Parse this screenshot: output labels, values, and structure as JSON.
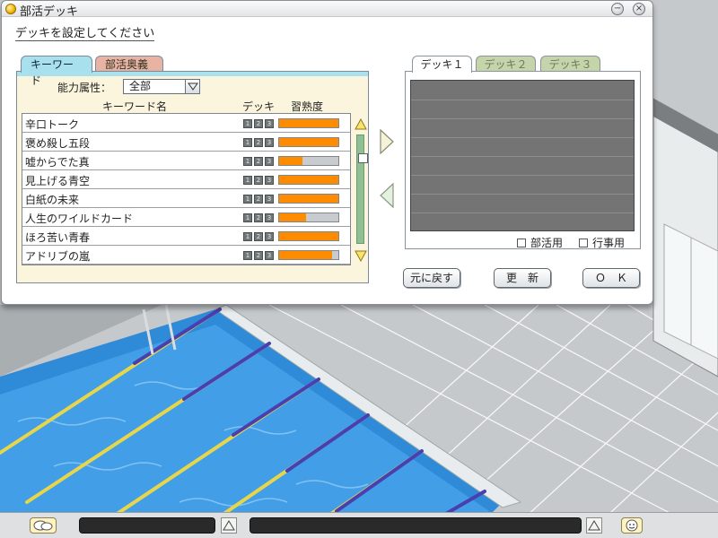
{
  "window": {
    "title": "部活デッキ",
    "prompt": "デッキを設定してください"
  },
  "left_tabs": [
    {
      "label": "キーワード",
      "active": true
    },
    {
      "label": "部活奥義",
      "active": false
    }
  ],
  "filter": {
    "label": "能力属性：",
    "value": "全部"
  },
  "columns": {
    "name": "キーワード名",
    "deck": "デッキ",
    "skill": "習熟度"
  },
  "keywords": [
    {
      "name": "辛口トーク",
      "proficiency": 1.0
    },
    {
      "name": "褒め殺し五段",
      "proficiency": 1.0
    },
    {
      "name": "嘘からでた真",
      "proficiency": 0.4
    },
    {
      "name": "見上げる青空",
      "proficiency": 1.0
    },
    {
      "name": "白紙の未来",
      "proficiency": 1.0
    },
    {
      "name": "人生のワイルドカード",
      "proficiency": 0.45
    },
    {
      "name": "ほろ苦い青春",
      "proficiency": 1.0
    },
    {
      "name": "アドリブの嵐",
      "proficiency": 0.9
    }
  ],
  "deck_slot_labels": [
    "1",
    "2",
    "3"
  ],
  "deck_tabs": [
    {
      "label": "デッキ１",
      "active": true
    },
    {
      "label": "デッキ２",
      "active": false
    },
    {
      "label": "デッキ３",
      "active": false
    }
  ],
  "deck_checks": {
    "club": "部活用",
    "event": "行事用"
  },
  "buttons": {
    "reset": "元に戻す",
    "update": "更　新",
    "ok": "Ｏ　Ｋ"
  },
  "colors": {
    "proficiency": "#ff8c00",
    "active_tab": "#a8e0ee",
    "inactive_tab": "#e8b3a2",
    "deck_tab_off": "#c5d4a9"
  }
}
